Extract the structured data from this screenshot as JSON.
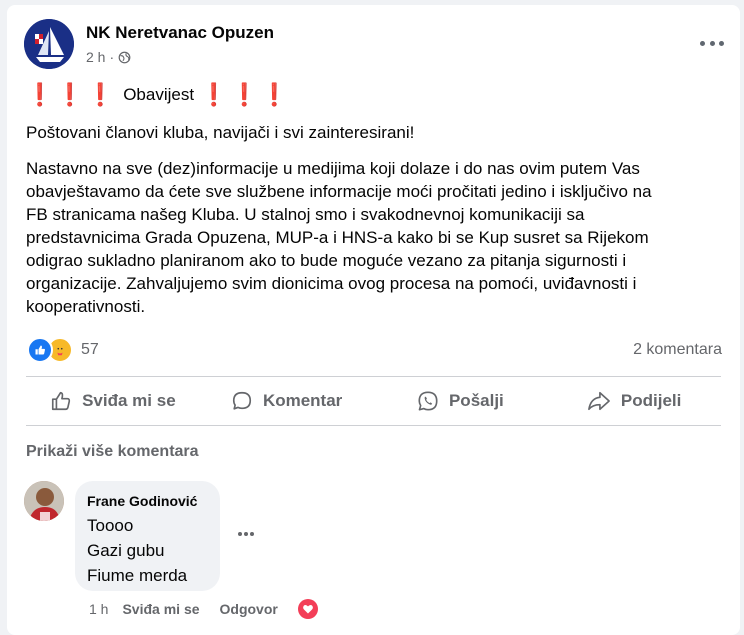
{
  "post": {
    "page_name": "NK Neretvanac Opuzen",
    "time": "2 h",
    "privacy_icon": "globe-icon",
    "title_marks": "❗❗❗",
    "title": "Obavijest",
    "greeting": "Poštovani članovi kluba, navijači i svi zainteresirani!",
    "body_lines": [
      "Nastavno na sve (dez)informacije u medijima koji dolaze i do nas ovim putem Vas",
      "obavještavamo da ćete sve službene informacije moći pročitati jedino i isključivo na",
      "FB stranicama našeg Kluba. U stalnoj smo i svakodnevnoj komunikaciji sa",
      "predstavnicima Grada Opuzena, MUP-a i HNS-a kako bi se Kup susret sa Rijekom",
      "odigrao sukladno planiranom ako to bude moguće vezano za pitanja sigurnosti i",
      "organizacije. Zahvaljujemo svim dionicima ovog procesa na pomoći, uviđavnosti i",
      "kooperativnosti."
    ]
  },
  "reactions": {
    "count": "57",
    "comments": "2 komentara",
    "icons": [
      "like-icon",
      "care-icon"
    ]
  },
  "actions": {
    "like": "Sviđa mi se",
    "comment": "Komentar",
    "send": "Pošalji",
    "share": "Podijeli"
  },
  "comments_section": {
    "view_more": "Prikaži više komentara",
    "comment": {
      "author": "Frane Godinović",
      "lines": [
        "Toooo",
        "Gazi gubu",
        "Fiume merda"
      ],
      "time": "1 h",
      "like": "Sviđa mi se",
      "reply": "Odgovor",
      "reaction_icon": "love-icon"
    }
  },
  "colors": {
    "accent": "#1877f2",
    "text": "#050505",
    "secondary": "#65676b",
    "exclamation": "#e0242e",
    "love": "#f33e58",
    "care": "#f7b928"
  }
}
